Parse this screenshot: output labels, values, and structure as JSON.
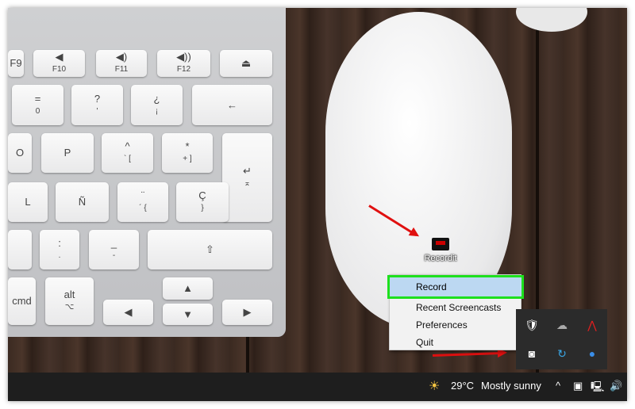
{
  "keyboard": {
    "keys": [
      {
        "t": "F9",
        "s": ""
      },
      {
        "t": "◀",
        "s": "F10"
      },
      {
        "t": "◀)",
        "s": "F11"
      },
      {
        "t": "◀))",
        "s": "F12"
      },
      {
        "t": "⏏",
        "s": ""
      },
      {
        "t": "=",
        "s": "0"
      },
      {
        "t": "?",
        "s": "'"
      },
      {
        "t": "¿",
        "s": "¡"
      },
      {
        "t": "←",
        "s": ""
      },
      {
        "t": "O",
        "s": ""
      },
      {
        "t": "P",
        "s": ""
      },
      {
        "t": "^",
        "s": "` ["
      },
      {
        "t": "*",
        "s": "+ ]"
      },
      {
        "t": "↵",
        "s": "⌅"
      },
      {
        "t": "L",
        "s": ""
      },
      {
        "t": "Ñ",
        "s": ""
      },
      {
        "t": "¨",
        "s": "´ {"
      },
      {
        "t": "Ç",
        "s": "}"
      },
      {
        "t": "",
        "s": ""
      },
      {
        "t": ":",
        "s": "."
      },
      {
        "t": "_",
        "s": "-"
      },
      {
        "t": "⇧",
        "s": ""
      },
      {
        "t": "cmd",
        "s": ""
      },
      {
        "t": "alt",
        "s": "⌥"
      },
      {
        "t": "◀",
        "s": ""
      },
      {
        "t": "▲",
        "s": ""
      },
      {
        "t": "▼",
        "s": ""
      },
      {
        "t": "▶",
        "s": ""
      }
    ]
  },
  "desktop_icon": {
    "label": "Recordit"
  },
  "context_menu": {
    "items": [
      "Record",
      "Recent Screencasts",
      "Preferences",
      "Quit"
    ],
    "highlight_color": "#1ee01e"
  },
  "tray_icons": [
    "security-warning-icon",
    "cloud-offline-icon",
    "app-red-icon",
    "recordit-icon",
    "sync-icon",
    "app-blue-icon"
  ],
  "taskbar": {
    "temperature": "29°C",
    "weather": "Mostly sunny"
  }
}
